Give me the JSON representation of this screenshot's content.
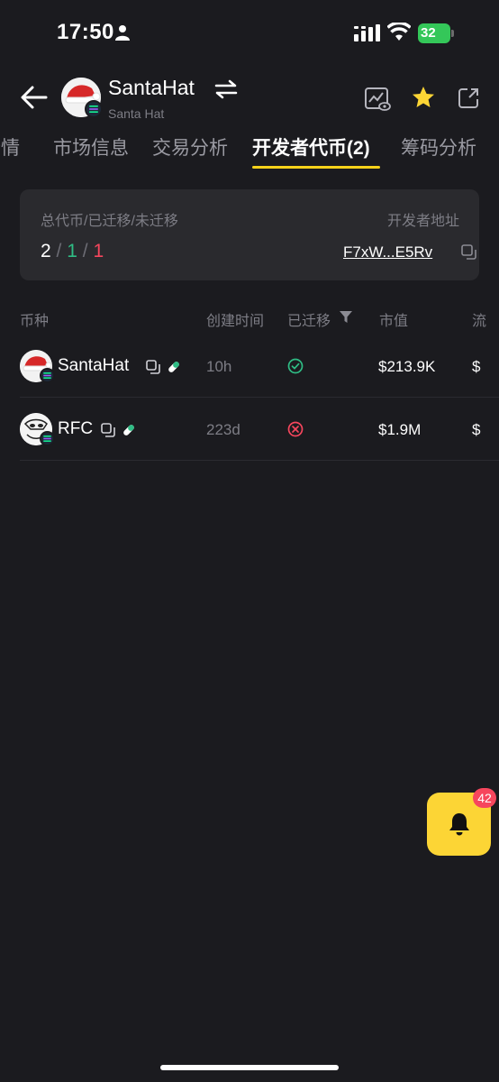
{
  "status_bar": {
    "time": "17:50",
    "battery": "32"
  },
  "header": {
    "token_name": "SantaHat",
    "token_subtitle": "Santa Hat"
  },
  "tabs": [
    {
      "label": "行情"
    },
    {
      "label": "市场信息"
    },
    {
      "label": "交易分析"
    },
    {
      "label": "开发者代币(2)",
      "active": true
    },
    {
      "label": "筹码分析"
    }
  ],
  "summary": {
    "label": "总代币/已迁移/未迁移",
    "total": "2",
    "migrated": "1",
    "unmigrated": "1",
    "separator": "/",
    "dev_label": "开发者地址",
    "dev_address": "F7xW...E5Rv"
  },
  "table": {
    "headers": [
      "币种",
      "创建时间",
      "已迁移",
      "市值",
      "流"
    ],
    "rows": [
      {
        "name": "SantaHat",
        "created": "10h",
        "migrated": true,
        "market_cap": "$213.9K",
        "cut": "$"
      },
      {
        "name": "RFC",
        "created": "223d",
        "migrated": false,
        "market_cap": "$1.9M",
        "cut": "$"
      }
    ]
  },
  "notification": {
    "count": "42"
  },
  "colors": {
    "accent": "#fcd535",
    "up": "#2fbd85",
    "down": "#f6465d",
    "background": "#1b1b1f"
  }
}
